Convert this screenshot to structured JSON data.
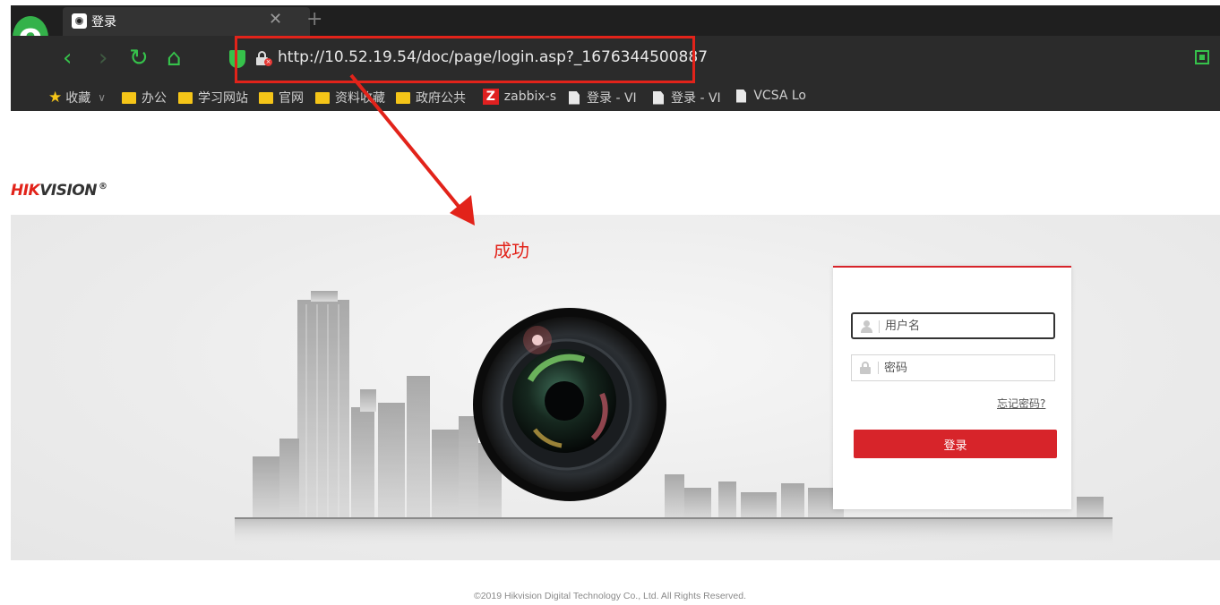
{
  "browser": {
    "tab_title": "登录",
    "tab_close": "✕",
    "new_tab": "+",
    "url": "http://10.52.19.54/doc/page/login.asp?_1676344500887",
    "nav": {
      "back": "‹",
      "forward": "›",
      "reload": "↻",
      "home": "⌂"
    },
    "logo_letter": "e",
    "alert_badge": "!",
    "bookmarks": [
      {
        "label": "收藏",
        "icon": "star-icon"
      },
      {
        "label": "办公",
        "icon": "folder-icon"
      },
      {
        "label": "学习网站",
        "icon": "folder-icon"
      },
      {
        "label": "官网",
        "icon": "folder-icon"
      },
      {
        "label": "资料收藏",
        "icon": "folder-icon"
      },
      {
        "label": "政府公共",
        "icon": "folder-icon"
      },
      {
        "label": "zabbix-s",
        "icon": "zabbix-icon"
      },
      {
        "label": "登录 - VI",
        "icon": "page-icon"
      },
      {
        "label": "登录 - VI",
        "icon": "page-icon"
      },
      {
        "label": "VCSA Lo",
        "icon": "page-icon"
      }
    ],
    "zabbix_letter": "Z",
    "bookmark_chevron": "∨"
  },
  "annotation": {
    "success_text": "成功",
    "color": "#e2231a"
  },
  "page": {
    "brand_red": "HIK",
    "brand_rest": "VISION",
    "brand_reg": "®",
    "login": {
      "username_placeholder": "用户名",
      "password_placeholder": "密码",
      "forgot_password": "忘记密码?",
      "submit": "登录",
      "accent": "#d7242a"
    },
    "copyright": "©2019 Hikvision Digital Technology Co., Ltd. All Rights Reserved."
  }
}
